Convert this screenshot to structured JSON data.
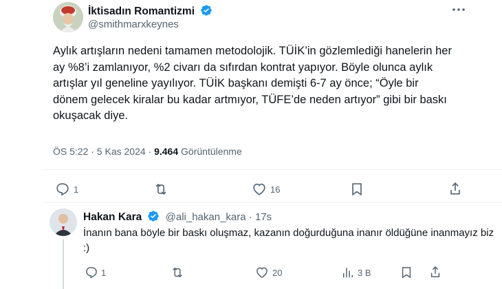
{
  "tweet": {
    "author_name": "İktisadın Romantizmi",
    "handle": "@smithmarxkeynes",
    "text": "Aylık artışların nedeni tamamen metodolojik. TÜİK’in gözlemlediği hanelerin her ay %8’i zamlanıyor, %2 civarı da sıfırdan kontrat yapıyor. Böyle olunca aylık artışlar yıl geneline yayılıyor. TÜİK başkanı demişti 6-7 ay önce; “Öyle bir dönem gelecek kiralar bu kadar artmıyor, TÜFE’de neden artıyor” gibi bir baskı okuşacak diye.",
    "timestamp": "ÖS 5:22 · 5 Kas 2024 ·",
    "views_count": "9.464",
    "views_label": "Görüntülenme",
    "actions": {
      "reply_count": "1",
      "retweet_count": "",
      "like_count": "16"
    }
  },
  "reply": {
    "author_name": "Hakan Kara",
    "handle_time": "@ali_hakan_kara · 17s",
    "text": "İnanın bana böyle bir baskı oluşmaz, kazanın doğurduğuna inanır öldüğüne inanmayız biz :)",
    "actions": {
      "reply_count": "1",
      "retweet_count": "",
      "like_count": "20",
      "views_count": "3 B"
    }
  },
  "colors": {
    "verified": "#1d9bf0",
    "text": "#0f1419",
    "muted": "#536471"
  },
  "icons": [
    "more-icon",
    "verified-badge-icon",
    "reply-icon",
    "retweet-icon",
    "like-icon",
    "bookmark-icon",
    "share-icon",
    "views-icon"
  ]
}
